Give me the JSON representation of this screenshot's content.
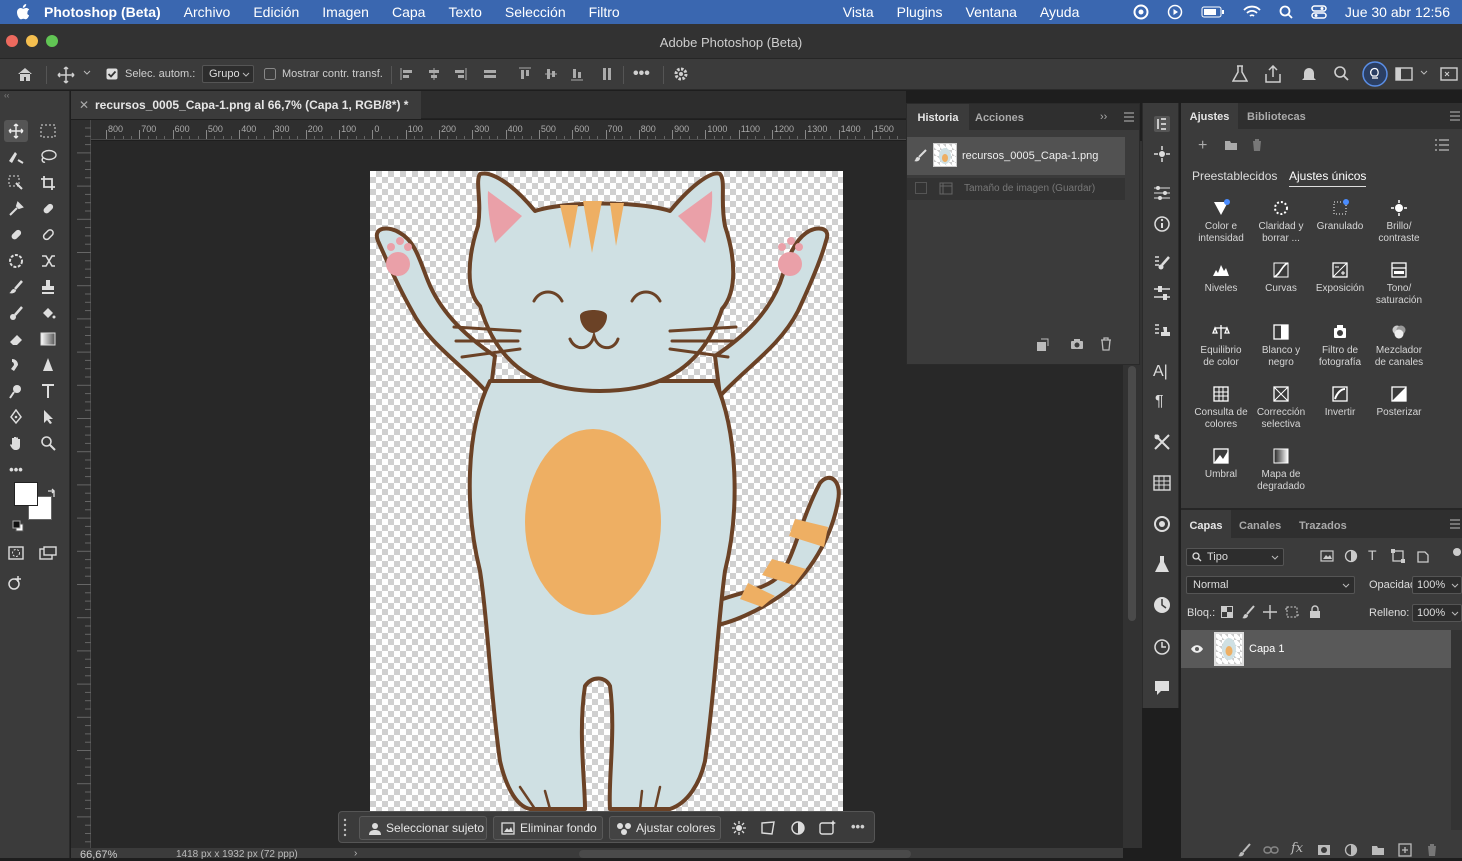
{
  "menubar": {
    "app": "Photoshop (Beta)",
    "items": [
      "Archivo",
      "Edición",
      "Imagen",
      "Capa",
      "Texto",
      "Selección",
      "Filtro",
      "Vista",
      "Plugins",
      "Ventana",
      "Ayuda"
    ],
    "datetime": "Jue 30 abr 12:56"
  },
  "window": {
    "title": "Adobe Photoshop (Beta)"
  },
  "options": {
    "auto_select_label": "Selec. autom.:",
    "auto_select_value": "Grupo",
    "show_transform_label": "Mostrar contr. transf."
  },
  "document": {
    "tab_title": "recursos_0005_Capa-1.png al 66,7% (Capa 1, RGB/8*) *",
    "zoom": "66,67%",
    "dimensions": "1418 px x 1932 px (72 ppp)"
  },
  "ruler": {
    "ticks": [
      "800",
      "700",
      "600",
      "500",
      "400",
      "300",
      "200",
      "100",
      "0",
      "100",
      "200",
      "300",
      "400",
      "500",
      "600",
      "700",
      "800",
      "900",
      "1000",
      "1100",
      "1200",
      "1300",
      "1400",
      "1500"
    ]
  },
  "context_bar": {
    "select_subject": "Seleccionar sujeto",
    "remove_bg": "Eliminar fondo",
    "adjust_colors": "Ajustar colores"
  },
  "history": {
    "tab_active": "Historia",
    "tab_other": "Acciones",
    "snapshot": "recursos_0005_Capa-1.png",
    "step": "Tamaño de imagen (Guardar)"
  },
  "adjustments": {
    "tab_active": "Ajustes",
    "tab_other": "Bibliotecas",
    "subtab_presets": "Preestablecidos",
    "subtab_single": "Ajustes únicos",
    "items": [
      {
        "l1": "Color e",
        "l2": "intensidad"
      },
      {
        "l1": "Claridad y",
        "l2": "borrar ..."
      },
      {
        "l1": "Granulado",
        "l2": ""
      },
      {
        "l1": "Brillo/",
        "l2": "contraste"
      },
      {
        "l1": "Niveles",
        "l2": ""
      },
      {
        "l1": "Curvas",
        "l2": ""
      },
      {
        "l1": "Exposición",
        "l2": ""
      },
      {
        "l1": "Tono/",
        "l2": "saturación"
      },
      {
        "l1": "Equilibrio",
        "l2": "de color"
      },
      {
        "l1": "Blanco y",
        "l2": "negro"
      },
      {
        "l1": "Filtro de",
        "l2": "fotografía"
      },
      {
        "l1": "Mezclador",
        "l2": "de canales"
      },
      {
        "l1": "Consulta de",
        "l2": "colores"
      },
      {
        "l1": "Corrección",
        "l2": "selectiva"
      },
      {
        "l1": "Invertir",
        "l2": ""
      },
      {
        "l1": "Posterizar",
        "l2": ""
      },
      {
        "l1": "Umbral",
        "l2": ""
      },
      {
        "l1": "Mapa de",
        "l2": "degradado"
      }
    ]
  },
  "layers": {
    "tab_active": "Capas",
    "tab_channels": "Canales",
    "tab_paths": "Trazados",
    "filter": "Tipo",
    "blend": "Normal",
    "opacity_label": "Opacidad:",
    "opacity": "100%",
    "lock_label": "Bloq.:",
    "fill_label": "Relleno:",
    "fill": "100%",
    "layer_name": "Capa 1"
  },
  "colors": {
    "menubar": "#3a67b0",
    "panel": "#3b3b3b",
    "cat_body": "#cfe0e3",
    "cat_outline": "#6b4226",
    "cat_accent": "#eeaf63"
  }
}
